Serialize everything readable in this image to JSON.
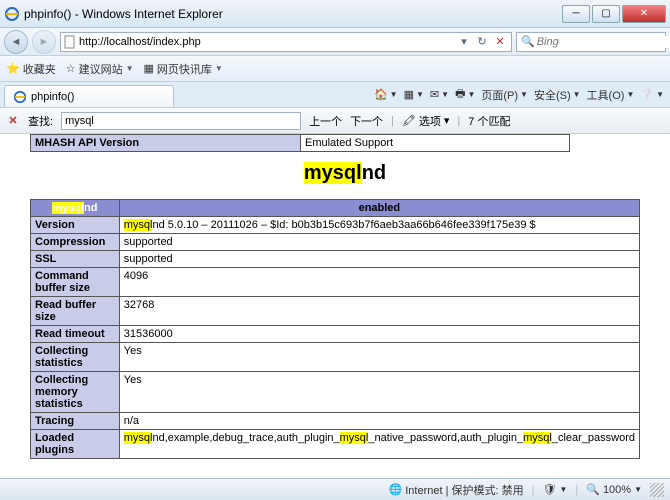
{
  "window": {
    "title": "phpinfo() - Windows Internet Explorer"
  },
  "address": {
    "url": "http://localhost/index.php"
  },
  "search": {
    "placeholder": "Bing"
  },
  "favbar": {
    "favorites": "收藏夹",
    "suggested": "建议网站",
    "slice": "网页快讯库"
  },
  "tab": {
    "label": "phpinfo()"
  },
  "toolbar": {
    "page": "页面(P)",
    "safety": "安全(S)",
    "tools": "工具(O)"
  },
  "find": {
    "label": "查找:",
    "value": "mysql",
    "prev": "上一个",
    "next": "下一个",
    "options": "选项",
    "matches": "7 个匹配"
  },
  "phpinfo": {
    "mhash_row": {
      "label": "MHASH API Version",
      "value": "Emulated Support"
    },
    "section_prefix": "mysql",
    "section_suffix": "nd",
    "table_header_left_prefix": "mysql",
    "table_header_left_suffix": "nd",
    "table_header_right": "enabled",
    "rows": [
      {
        "k": "Version",
        "v_pre": "mysql",
        "v_post": "nd 5.0.10 – 20111026 – $Id: b0b3b15c693b7f6aeb3aa66b646fee339f175e39 $"
      },
      {
        "k": "Compression",
        "v": "supported"
      },
      {
        "k": "SSL",
        "v": "supported"
      },
      {
        "k": "Command buffer size",
        "v": "4096"
      },
      {
        "k": "Read buffer size",
        "v": "32768"
      },
      {
        "k": "Read timeout",
        "v": "31536000"
      },
      {
        "k": "Collecting statistics",
        "v": "Yes"
      },
      {
        "k": "Collecting memory statistics",
        "v": "Yes"
      },
      {
        "k": "Tracing",
        "v": "n/a"
      },
      {
        "k": "Loaded plugins",
        "segments": [
          "mysql",
          "nd,example,debug_trace,auth_plugin_",
          "mysql",
          "_native_password,auth_plugin_",
          "mysql",
          "_clear_password"
        ]
      }
    ]
  },
  "status": {
    "zone": "Internet | 保护模式: 禁用",
    "zoom": "100%"
  }
}
